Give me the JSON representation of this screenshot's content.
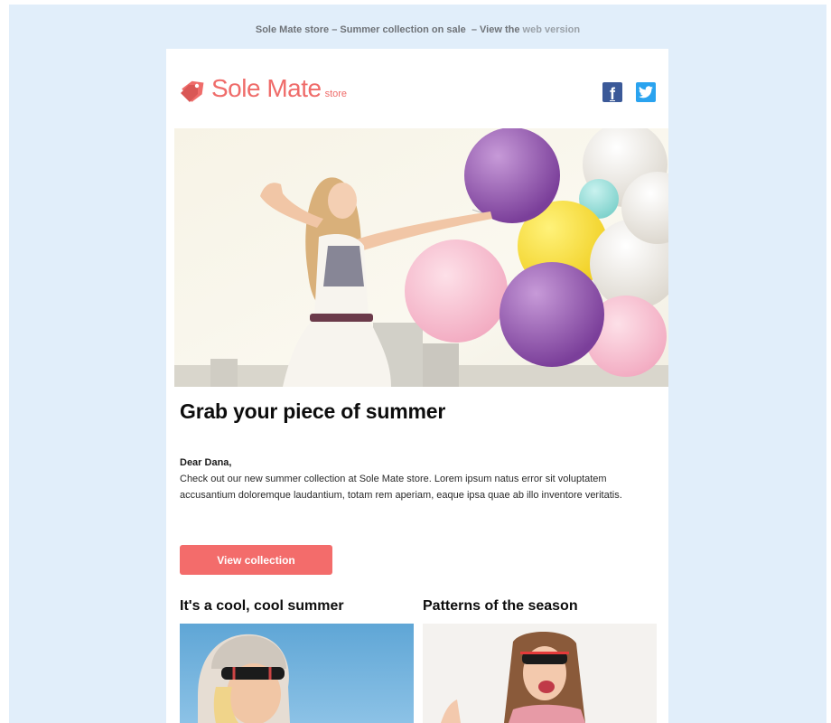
{
  "preheader": {
    "text": "Sole Mate store – Summer collection on sale",
    "view_prefix": "– View the",
    "link_label": "web version"
  },
  "brand": {
    "name": "Sole Mate",
    "suffix": "store",
    "color": "#ef6c6a"
  },
  "social": {
    "facebook_glyph": "f",
    "twitter_icon": "twitter-icon",
    "facebook_color": "#3b5998",
    "twitter_color": "#2aa3ef"
  },
  "main": {
    "headline": "Grab your piece of summer",
    "greeting": "Dear Dana,",
    "body": "Check out our new summer collection at Sole Mate store. Lorem ipsum natus error sit voluptatem accusantium doloremque laudantium, totam rem aperiam, eaque ipsa quae ab illo inventore veritatis.",
    "cta_label": "View collection",
    "cta_color": "#f36c6b"
  },
  "columns": [
    {
      "title": "It's a cool, cool summer"
    },
    {
      "title": "Patterns of the season"
    }
  ],
  "colors": {
    "page_background": "#e1eefa"
  }
}
